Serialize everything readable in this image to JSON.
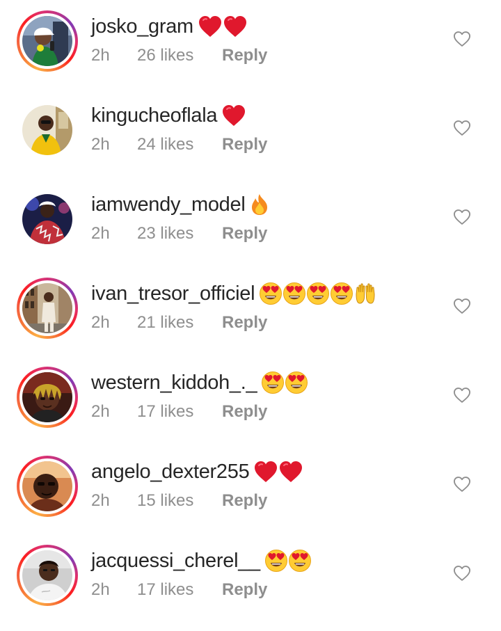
{
  "comments": [
    {
      "username": "josko_gram",
      "time": "2h",
      "likes": "26 likes",
      "reply": "Reply",
      "emojis": [
        "red-heart",
        "red-heart"
      ],
      "ring": true,
      "avatar": "photo-person-cap"
    },
    {
      "username": "kingucheoflala",
      "time": "2h",
      "likes": "24 likes",
      "reply": "Reply",
      "emojis": [
        "red-heart"
      ],
      "ring": false,
      "avatar": "photo-person-yellow"
    },
    {
      "username": "iamwendy_model",
      "time": "2h",
      "likes": "23 likes",
      "reply": "Reply",
      "emojis": [
        "fire"
      ],
      "ring": false,
      "avatar": "photo-person-stage"
    },
    {
      "username": "ivan_tresor_officiel",
      "time": "2h",
      "likes": "21 likes",
      "reply": "Reply",
      "emojis": [
        "heart-eyes",
        "heart-eyes",
        "heart-eyes",
        "heart-eyes",
        "raising-hands"
      ],
      "ring": true,
      "avatar": "photo-person-street"
    },
    {
      "username": "western_kiddoh_._",
      "time": "2h",
      "likes": "17 likes",
      "reply": "Reply",
      "emojis": [
        "heart-eyes",
        "heart-eyes"
      ],
      "ring": true,
      "avatar": "photo-person-dreads"
    },
    {
      "username": "angelo_dexter255",
      "time": "2h",
      "likes": "15 likes",
      "reply": "Reply",
      "emojis": [
        "red-heart",
        "red-heart"
      ],
      "ring": true,
      "avatar": "photo-person-warm"
    },
    {
      "username": "jacquessi_cherel__",
      "time": "2h",
      "likes": "17 likes",
      "reply": "Reply",
      "emojis": [
        "heart-eyes",
        "heart-eyes"
      ],
      "ring": true,
      "avatar": "photo-person-selfie"
    }
  ],
  "like_icon": "heart-outline-icon",
  "colors": {
    "text": "#262626",
    "secondary": "#8e8e8e",
    "heart": "#e0182d",
    "emoji_face": "#ffcc33"
  }
}
